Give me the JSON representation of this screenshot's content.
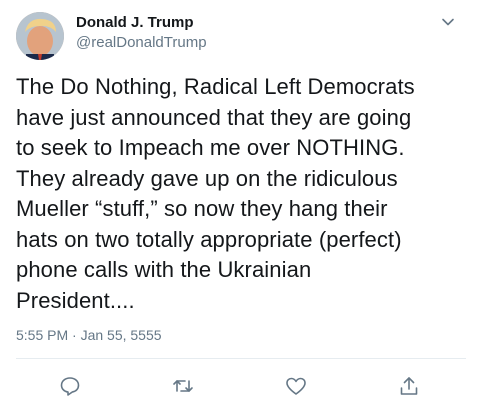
{
  "tweet": {
    "display_name": "Donald J. Trump",
    "handle": "@realDonaldTrump",
    "text": "The Do Nothing, Radical Left Democrats\nhave just announced that they are going\nto seek to Impeach me over NOTHING.\nThey already gave up on the ridiculous\nMueller “stuff,” so now they hang their\nhats on two totally appropriate (perfect)\nphone calls with the Ukrainian\nPresident....",
    "timestamp": "5:55 PM · Jan 55, 5555"
  },
  "icons": {
    "menu": "chevron-down-icon",
    "reply": "reply-icon",
    "retweet": "retweet-icon",
    "like": "like-icon",
    "share": "share-icon"
  },
  "colors": {
    "text": "#14171a",
    "secondary": "#657786",
    "divider": "#e6ecf0",
    "icon": "#657786"
  }
}
